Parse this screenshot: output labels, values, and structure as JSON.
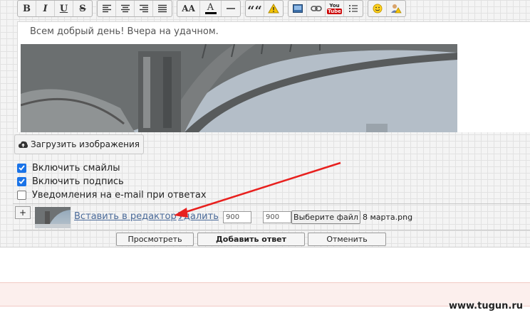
{
  "toolbar": {
    "groups": [
      [
        "bold-icon",
        "italic-icon",
        "underline-icon",
        "strikethrough-icon"
      ],
      [
        "align-left-icon",
        "align-center-icon",
        "align-right-icon",
        "align-justify-icon"
      ],
      [
        "font-size-icon",
        "font-color-icon",
        "horizontal-rule-icon"
      ],
      [
        "quote-icon",
        "spoiler-icon"
      ],
      [
        "image-icon",
        "link-icon",
        "youtube-icon",
        "list-icon"
      ],
      [
        "smiley-icon",
        "user-mention-icon"
      ]
    ],
    "bold": "B",
    "italic": "I",
    "underline": "U",
    "strike": "S",
    "font_size": "AA",
    "font_color": "A",
    "quote": "““",
    "youtube_top": "You",
    "youtube_bottom": "Tube",
    "accent_red": "#cc0000"
  },
  "editor": {
    "text": "Всем добрый день! Вчера на удачном."
  },
  "upload": {
    "label": "Загрузить изображения",
    "icon": "cloud-upload-icon"
  },
  "options": [
    {
      "label": "Включить смайлы",
      "checked": true
    },
    {
      "label": "Включить подпись",
      "checked": true
    },
    {
      "label": "Уведомления на e-mail при ответах",
      "checked": false
    }
  ],
  "attachment": {
    "add_label": "+",
    "insert_link": "Вставить в редактор",
    "delete_link": "Удалить",
    "width": "900",
    "height": "900",
    "times": "X",
    "choose_file": "Выберите файл",
    "file_name": "8 марта.png"
  },
  "buttons": {
    "preview": "Просмотреть",
    "submit": "Добавить ответ",
    "cancel": "Отменить"
  },
  "watermark": "www.tugun.ru",
  "colors": {
    "checkbox_blue": "#1a73e8",
    "link_blue": "#4a6a99",
    "annotation_red": "#e8201e"
  }
}
